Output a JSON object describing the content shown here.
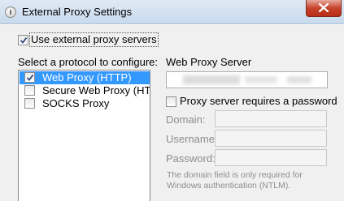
{
  "window": {
    "title": "External Proxy Settings"
  },
  "use_external_proxy": {
    "label": "Use external proxy servers",
    "checked": true
  },
  "protocols": {
    "label": "Select a protocol to configure:",
    "items": [
      {
        "label": "Web Proxy (HTTP)",
        "checked": true,
        "selected": true
      },
      {
        "label": "Secure Web Proxy (HT...",
        "checked": false,
        "selected": false
      },
      {
        "label": "SOCKS Proxy",
        "checked": false,
        "selected": false
      }
    ]
  },
  "server": {
    "label": "Web Proxy Server"
  },
  "auth": {
    "requires_password_label": "Proxy server requires a password",
    "requires_password_checked": false,
    "domain_label": "Domain:",
    "username_label": "Username:",
    "password_label": "Password:",
    "note": "The domain field is only required for Windows authentication (NTLM)."
  },
  "colors": {
    "selection": "#3399ff",
    "close_button": "#c7432c",
    "disabled_text": "#8d8d8d"
  }
}
